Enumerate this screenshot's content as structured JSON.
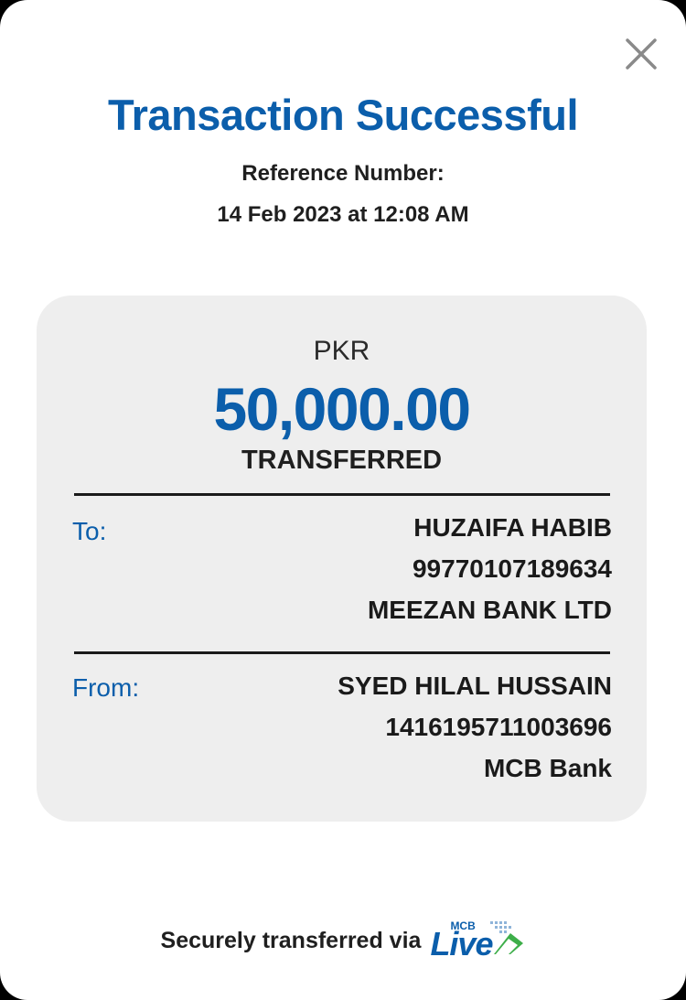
{
  "header": {
    "title": "Transaction Successful",
    "reference_label": "Reference Number:",
    "datetime": "14 Feb 2023 at 12:08 AM"
  },
  "summary": {
    "currency": "PKR",
    "amount": "50,000.00",
    "status": "TRANSFERRED"
  },
  "to": {
    "label": "To:",
    "name": "HUZAIFA HABIB",
    "account": "99770107189634",
    "bank": "MEEZAN BANK LTD"
  },
  "from": {
    "label": "From:",
    "name": "SYED HILAL HUSSAIN",
    "account": "1416195711003696",
    "bank": "MCB Bank"
  },
  "footer": {
    "text": "Securely transferred via",
    "logo_small": "MCB",
    "logo_word": "Live"
  },
  "icons": {
    "close": "close-icon"
  },
  "colors": {
    "accent": "#0b5eab",
    "card_background": "#eeeeee",
    "logo_green": "#3dae49"
  }
}
